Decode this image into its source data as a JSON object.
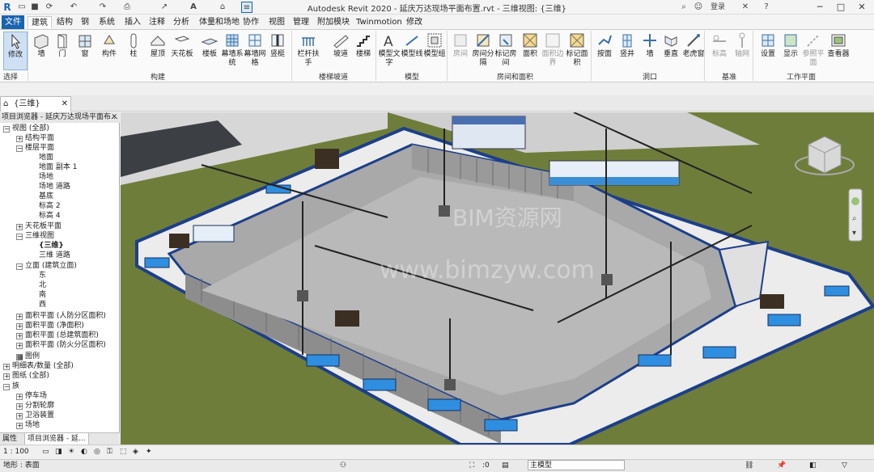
{
  "title_bar": {
    "title": "Autodesk Revit 2020 - 延庆万达现场平面布置.rvt - 三维视图: {三维}",
    "login_label": "登录",
    "help_label": "?"
  },
  "tabs": [
    "文件",
    "建筑",
    "结构",
    "钢",
    "系统",
    "插入",
    "注释",
    "分析",
    "体量和场地",
    "协作",
    "视图",
    "管理",
    "附加模块",
    "Twinmotion",
    "修改"
  ],
  "ribbon": {
    "modify": "修改",
    "select": "选择",
    "build": {
      "wall": "墙",
      "door": "门",
      "window": "窗",
      "component": "构件",
      "column": "柱",
      "roof": "屋顶",
      "ceiling": "天花板",
      "floor": "楼板",
      "curtain_system": "幕墙系统",
      "curtain_grid": "幕墙网格",
      "mullion": "竖梃"
    },
    "circulation": {
      "railing": "栏杆扶手",
      "ramp": "坡道",
      "stair": "楼梯"
    },
    "model": {
      "model_text": "模型文字",
      "model_line": "模型线",
      "model_group": "模型组"
    },
    "room_area": {
      "room": "房间",
      "room_separator": "房间分隔",
      "tag_room": "标记房间",
      "area": "面积",
      "area_boundary": "面积边界",
      "tag_area": "标记面积"
    },
    "opening": {
      "by_face": "按面",
      "shaft": "竖井",
      "wall": "墙",
      "vertical": "垂直",
      "dormer": "老虎窗"
    },
    "datum": {
      "level": "标高",
      "grid": "轴网"
    },
    "work_plane": {
      "set": "设置",
      "show": "显示",
      "ref_plane": "参照平面",
      "viewer": "查看器"
    },
    "groups": {
      "select": "选择",
      "build": "构建",
      "circulation": "楼梯坡道",
      "model": "模型",
      "room_area": "房间和面积",
      "opening": "洞口",
      "datum": "基准",
      "work_plane": "工作平面"
    }
  },
  "view_tab": "{三维}",
  "browser": {
    "header": "项目浏览器 - 延庆万达现场平面布...",
    "nodes": [
      "视图 (全部)",
      "结构平面",
      "楼层平面",
      "地面",
      "地面 副本 1",
      "场地",
      "场地 道路",
      "基底",
      "标高 2",
      "标高 4",
      "天花板平面",
      "三维视图",
      "{三维}",
      "三维 道路",
      "立面 (建筑立面)",
      "东",
      "北",
      "南",
      "西",
      "面积平面 (人防分区面积)",
      "面积平面 (净面积)",
      "面积平面 (总建筑面积)",
      "面积平面 (防火分区面积)",
      "图例",
      "明细表/数量 (全部)",
      "图纸 (全部)",
      "族",
      "停车场",
      "分割轮廓",
      "卫浴装置",
      "场地"
    ],
    "tab_properties": "属性",
    "tab_browser": "项目浏览器 - 延..."
  },
  "viewport": {
    "watermark_top": "BIM资源网",
    "watermark_bottom": "www.bimzyw.com"
  },
  "status": {
    "scale": "1 : 100",
    "left_text": "地形 : 表面",
    "coord": ":0",
    "model_label": "主模型"
  }
}
